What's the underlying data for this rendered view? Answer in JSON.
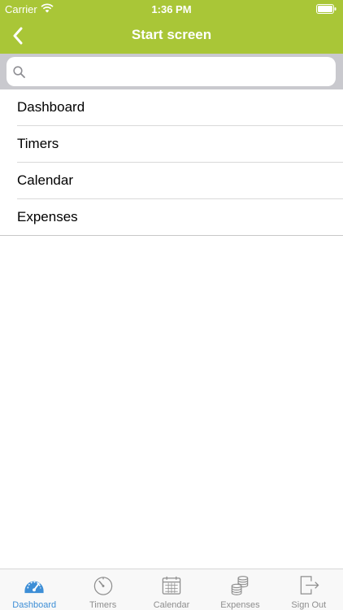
{
  "status_bar": {
    "carrier": "Carrier",
    "time": "1:36 PM"
  },
  "nav": {
    "title": "Start screen"
  },
  "search": {
    "value": "",
    "placeholder": ""
  },
  "menu": {
    "items": [
      {
        "label": "Dashboard"
      },
      {
        "label": "Timers"
      },
      {
        "label": "Calendar"
      },
      {
        "label": "Expenses"
      }
    ]
  },
  "tabs": [
    {
      "label": "Dashboard",
      "icon": "dashboard-icon",
      "active": true
    },
    {
      "label": "Timers",
      "icon": "timer-icon",
      "active": false
    },
    {
      "label": "Calendar",
      "icon": "calendar-icon",
      "active": false
    },
    {
      "label": "Expenses",
      "icon": "coins-icon",
      "active": false
    },
    {
      "label": "Sign Out",
      "icon": "sign-out-icon",
      "active": false
    }
  ],
  "colors": {
    "brand": "#a9c637",
    "tab_active": "#3d8ed6",
    "tab_inactive": "#8e8e8e"
  }
}
